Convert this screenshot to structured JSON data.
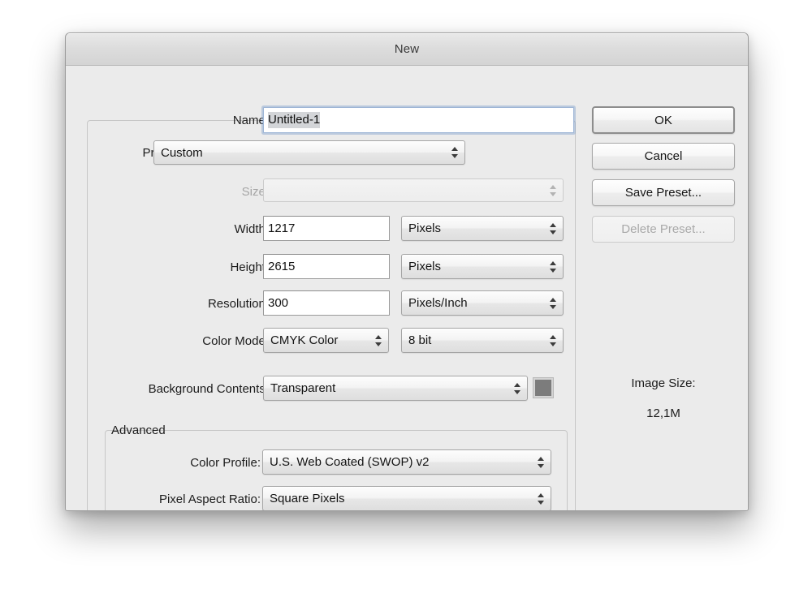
{
  "window": {
    "title": "New"
  },
  "form": {
    "name": {
      "label": "Name:",
      "value": "Untitled-1",
      "placeholder": "Untitled-1"
    },
    "preset": {
      "label": "Preset:",
      "value": "Custom"
    },
    "size": {
      "label": "Size:",
      "value": "",
      "disabled": true
    },
    "width": {
      "label": "Width:",
      "value": "1217",
      "unit": "Pixels"
    },
    "height": {
      "label": "Height:",
      "value": "2615",
      "unit": "Pixels"
    },
    "resolution": {
      "label": "Resolution:",
      "value": "300",
      "unit": "Pixels/Inch"
    },
    "color_mode": {
      "label": "Color Mode:",
      "value": "CMYK Color",
      "depth": "8 bit"
    },
    "background_contents": {
      "label": "Background Contents:",
      "value": "Transparent",
      "swatch_color": "#7c7c7c"
    },
    "advanced": {
      "legend": "Advanced",
      "color_profile": {
        "label": "Color Profile:",
        "value": "U.S. Web Coated (SWOP) v2"
      },
      "pixel_aspect_ratio": {
        "label": "Pixel Aspect Ratio:",
        "value": "Square Pixels"
      }
    }
  },
  "buttons": {
    "ok": "OK",
    "cancel": "Cancel",
    "save_preset": "Save Preset...",
    "delete_preset": "Delete Preset..."
  },
  "image_size": {
    "label": "Image Size:",
    "value": "12,1M"
  }
}
